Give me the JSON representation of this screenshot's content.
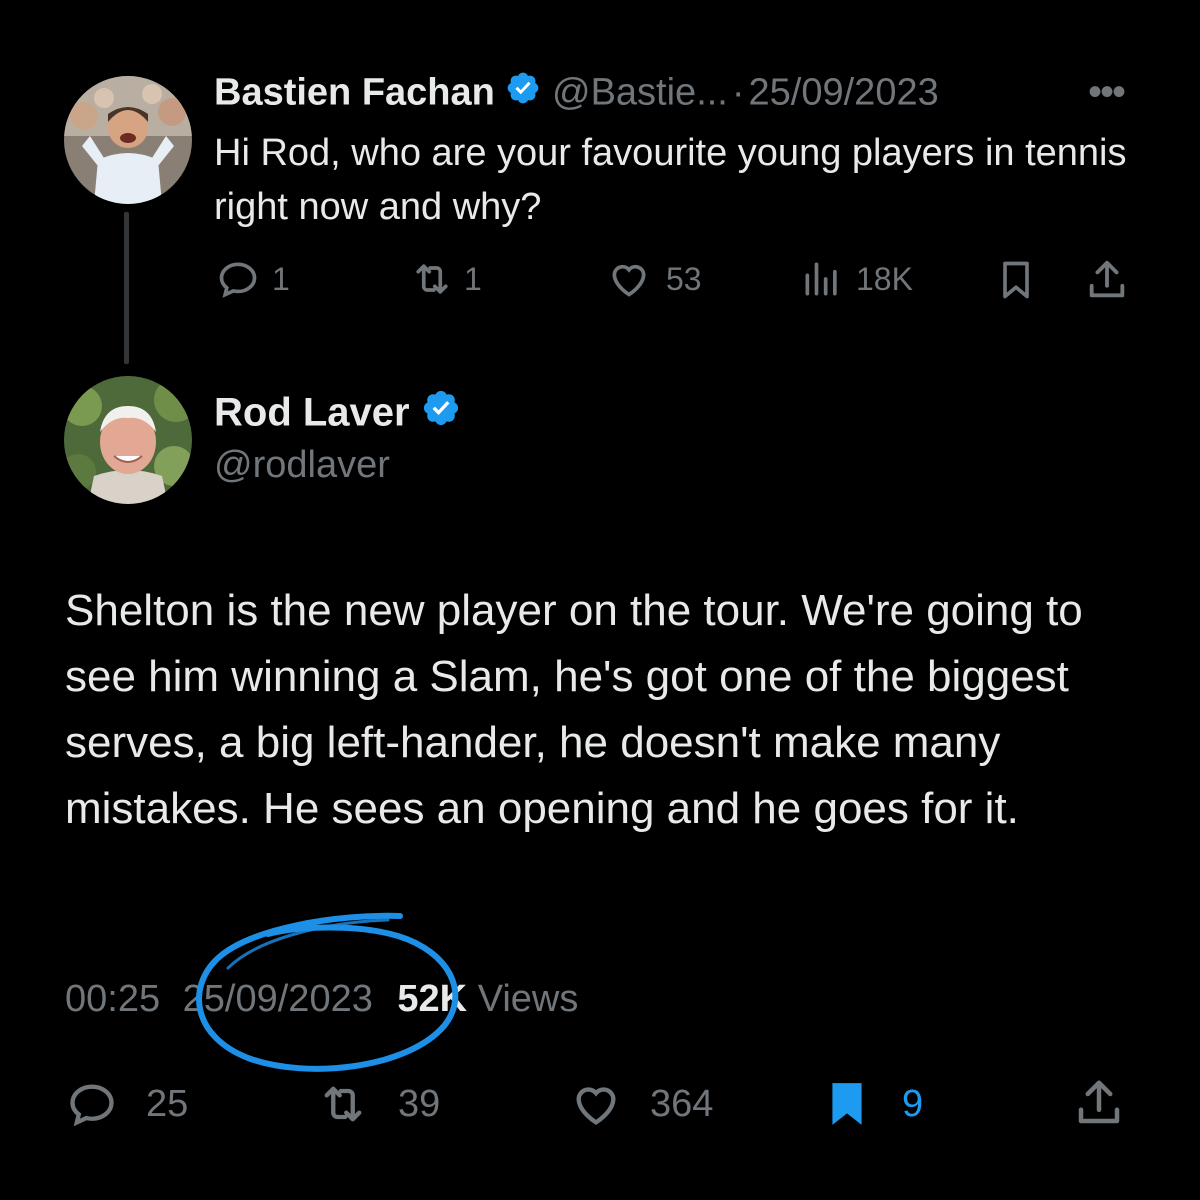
{
  "reply": {
    "author_name": "Bastien Fachan",
    "handle": "@Bastie...",
    "separator": "·",
    "date": "25/09/2023",
    "more_icon": "more-horizontal-icon",
    "text": "Hi Rod, who are your favourite young players in tennis right now and why?",
    "stats": {
      "replies": "1",
      "reposts": "1",
      "likes": "53",
      "views": "18K"
    }
  },
  "main": {
    "author_name": "Rod Laver",
    "handle": "@rodlaver",
    "text": "Shelton is the new player on the tour. We're going to see him winning a Slam, he's got one of the biggest serves, a big left-hander, he doesn't make many mistakes. He sees an opening and he goes for it.",
    "time": "00:25",
    "date": "25/09/2023",
    "views_count": "52K",
    "views_label": "Views",
    "stats": {
      "replies": "25",
      "reposts": "39",
      "likes": "364",
      "bookmarks": "9"
    }
  },
  "colors": {
    "background": "#000000",
    "text": "#e7e9ea",
    "muted": "#71767b",
    "verified": "#1d9bf0",
    "bookmark_active": "#1d9bf0",
    "annotation_circle": "#1d8fe6"
  }
}
